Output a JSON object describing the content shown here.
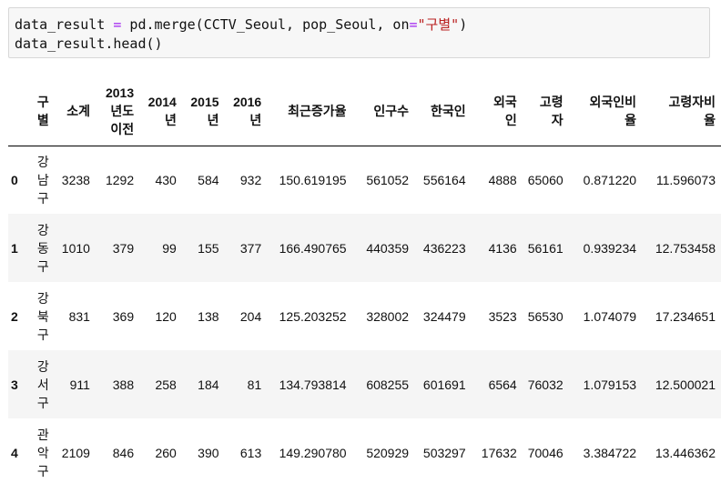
{
  "code": {
    "line1_parts": {
      "a": "data_result ",
      "op1": "=",
      "b": " pd.merge(CCTV_Seoul, pop_Seoul, on",
      "op2": "=",
      "str": "\"구별\"",
      "c": ")"
    },
    "line2": "data_result.head()"
  },
  "table": {
    "columns": [
      "구\n별",
      "소계",
      "2013\n년도\n이전",
      "2014\n년",
      "2015\n년",
      "2016\n년",
      "최근증가율",
      "인구수",
      "한국인",
      "외국\n인",
      "고령\n자",
      "외국인비\n율",
      "고령자비\n율"
    ],
    "rows": [
      {
        "index": "0",
        "values": [
          "강\n남\n구",
          "3238",
          "1292",
          "430",
          "584",
          "932",
          "150.619195",
          "561052",
          "556164",
          "4888",
          "65060",
          "0.871220",
          "11.596073"
        ]
      },
      {
        "index": "1",
        "values": [
          "강\n동\n구",
          "1010",
          "379",
          "99",
          "155",
          "377",
          "166.490765",
          "440359",
          "436223",
          "4136",
          "56161",
          "0.939234",
          "12.753458"
        ]
      },
      {
        "index": "2",
        "values": [
          "강\n북\n구",
          "831",
          "369",
          "120",
          "138",
          "204",
          "125.203252",
          "328002",
          "324479",
          "3523",
          "56530",
          "1.074079",
          "17.234651"
        ]
      },
      {
        "index": "3",
        "values": [
          "강\n서\n구",
          "911",
          "388",
          "258",
          "184",
          "81",
          "134.793814",
          "608255",
          "601691",
          "6564",
          "76032",
          "1.079153",
          "12.500021"
        ]
      },
      {
        "index": "4",
        "values": [
          "관\n악\n구",
          "2109",
          "846",
          "260",
          "390",
          "613",
          "149.290780",
          "520929",
          "503297",
          "17632",
          "70046",
          "3.384722",
          "13.446362"
        ]
      }
    ]
  }
}
